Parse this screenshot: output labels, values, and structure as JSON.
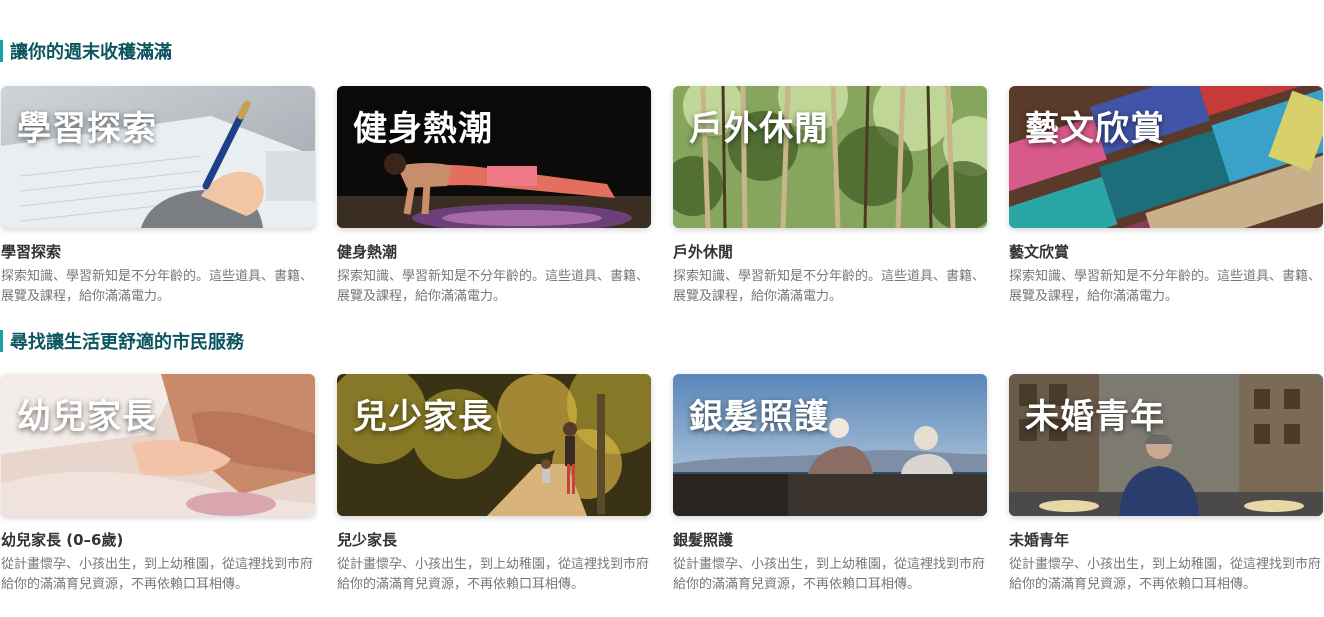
{
  "sections": [
    {
      "title": "讓你的週末收穫滿滿",
      "cards": [
        {
          "overlay": "學習探索",
          "title": "學習探索",
          "desc": "探索知識、學習新知是不分年齡的。這些道具、書籍、展覽及課程，給你滿滿電力。"
        },
        {
          "overlay": "健身熱潮",
          "title": "健身熱潮",
          "desc": "探索知識、學習新知是不分年齡的。這些道具、書籍、展覽及課程，給你滿滿電力。"
        },
        {
          "overlay": "戶外休閒",
          "title": "戶外休閒",
          "desc": "探索知識、學習新知是不分年齡的。這些道具、書籍、展覽及課程，給你滿滿電力。"
        },
        {
          "overlay": "藝文欣賞",
          "title": "藝文欣賞",
          "desc": "探索知識、學習新知是不分年齡的。這些道具、書籍、展覽及課程，給你滿滿電力。"
        }
      ]
    },
    {
      "title": "尋找讓生活更舒適的市民服務",
      "cards": [
        {
          "overlay": "幼兒家長",
          "title": "幼兒家長 (0–6歲)",
          "desc": "從計畫懷孕、小孩出生，到上幼稚園，從這裡找到市府給你的滿滿育兒資源，不再依賴口耳相傳。"
        },
        {
          "overlay": "兒少家長",
          "title": "兒少家長",
          "desc": "從計畫懷孕、小孩出生，到上幼稚園，從這裡找到市府給你的滿滿育兒資源，不再依賴口耳相傳。"
        },
        {
          "overlay": "銀髮照護",
          "title": "銀髮照護",
          "desc": "從計畫懷孕、小孩出生，到上幼稚園，從這裡找到市府給你的滿滿育兒資源，不再依賴口耳相傳。"
        },
        {
          "overlay": "未婚青年",
          "title": "未婚青年",
          "desc": "從計畫懷孕、小孩出生，到上幼稚園，從這裡找到市府給你的滿滿育兒資源，不再依賴口耳相傳。"
        }
      ]
    }
  ],
  "colors": {
    "accent": "#14a3a0",
    "heading": "#0b5560"
  }
}
